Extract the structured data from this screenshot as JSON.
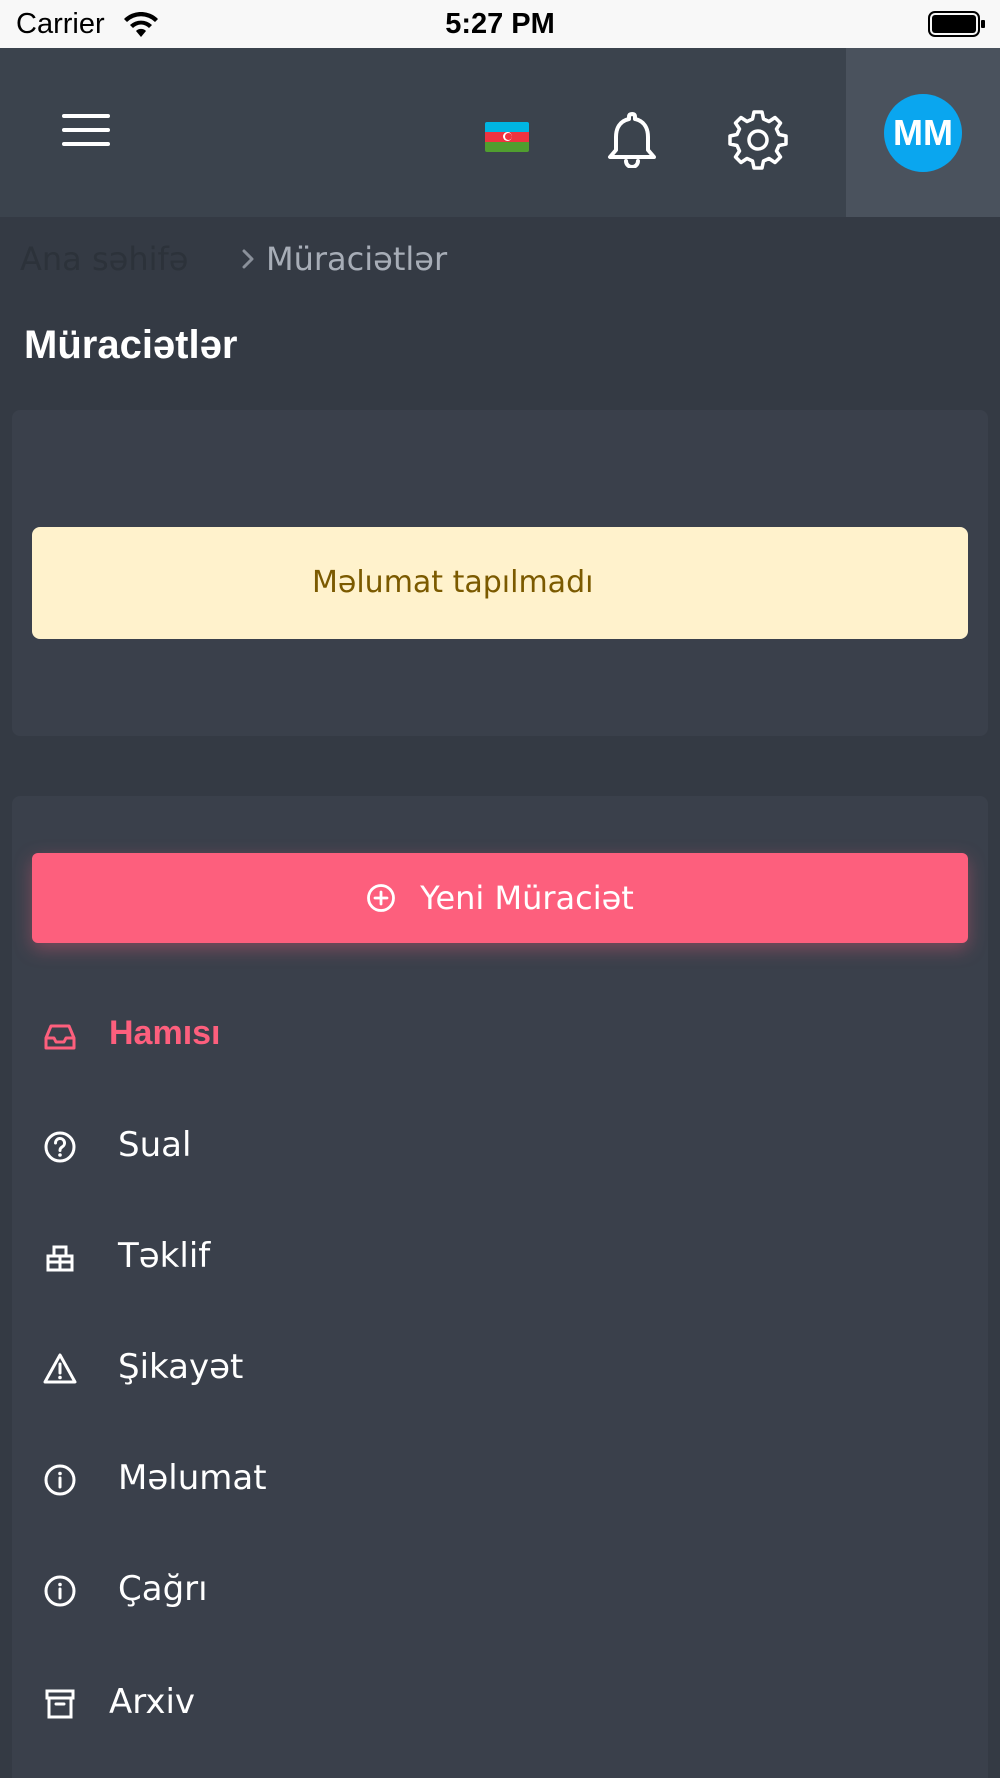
{
  "status_bar": {
    "carrier": "Carrier",
    "time": "5:27 PM"
  },
  "navbar": {
    "avatar_initials": "MM"
  },
  "breadcrumb": {
    "home": "Ana səhifə",
    "current": "Müraciətlər"
  },
  "page": {
    "title": "Müraciətlər"
  },
  "alert": {
    "text": "Məlumat tapılmadı"
  },
  "actions": {
    "new_label": "Yeni Müraciət"
  },
  "menu": {
    "items": [
      {
        "label": "Hamısı",
        "icon": "inbox-icon",
        "active": true
      },
      {
        "label": "Sual",
        "icon": "question-circle-icon"
      },
      {
        "label": "Təklif",
        "icon": "gift-box-icon"
      },
      {
        "label": "Şikayət",
        "icon": "warning-triangle-icon"
      },
      {
        "label": "Məlumat",
        "icon": "info-circle-icon"
      },
      {
        "label": "Çağrı",
        "icon": "info-circle-icon"
      },
      {
        "label": "Arxiv",
        "icon": "archive-icon"
      }
    ]
  },
  "colors": {
    "accent": "#fd5f7d",
    "avatar": "#0aa6ef",
    "background": "#343a44",
    "card": "#3a404b",
    "alert_bg": "#fff2cc",
    "alert_text": "#7b5a00"
  }
}
